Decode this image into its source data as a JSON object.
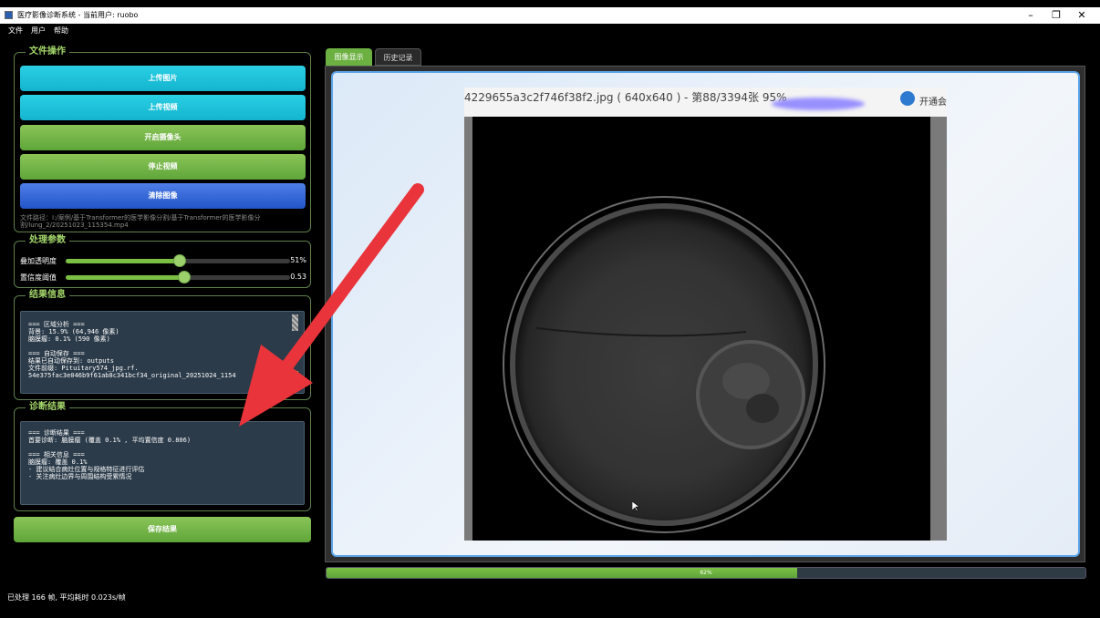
{
  "window": {
    "title": "医疗影像诊断系统 - 当前用户: ruobo",
    "minimize": "–",
    "maximize": "❐",
    "close": "✕"
  },
  "menu": [
    "文件",
    "用户",
    "帮助"
  ],
  "file_ops": {
    "title": "文件操作",
    "buttons": [
      "上传图片",
      "上传视频",
      "开启摄像头",
      "停止视频",
      "清除图像"
    ],
    "path": "文件路径：I:/案例/基于Transformer的医学影像分割/基于Transformer的医学影像分割/lung_2/20251023_115354.mp4"
  },
  "params": {
    "title": "处理参数",
    "overlay_label": "叠加透明度",
    "overlay_value": "51%",
    "overlay_level": 0.51,
    "conf_label": "置信度阈值",
    "conf_value": "0.53",
    "conf_level": 0.53
  },
  "result_info": {
    "title": "结果信息",
    "text": "=== 区域分析 ===\n背景: 15.9% (64,946 像素)\n脑膜瘤: 0.1% (590 像素)\n\n=== 自动保存 ===\n结果已自动保存到: outputs\n文件前缀: Pituitary574_jpg.rf.\n54e375fac3e046b9f61ab8c341bcf34_original_20251024_1154"
  },
  "diagnosis": {
    "title": "诊断结果",
    "text": "=== 诊断结果 ===\n首要诊断: 脑膜瘤 (覆盖 0.1% , 平均置信度 0.806)\n\n=== 相关信息 ===\n脑膜瘤: 覆盖 0.1%\n- 建议结合病灶位置与规格特征进行评估\n- 关注病灶边界与周围结构受累情况"
  },
  "save_button": "保存结果",
  "status": "已处理 166 帧, 平均耗时 0.023s/帧",
  "tabs": [
    "图像显示",
    "历史记录"
  ],
  "image_view": {
    "caption": "4229655a3c2f746f38f2.jpg ( 640x640 ) - 第88/3394张 95%",
    "share_text": "开通会"
  },
  "progress": {
    "value": 62,
    "label": "62%"
  },
  "colors": {
    "accent_green": "#7bc043",
    "cyan": "#14b4cf",
    "blue": "#2255c8",
    "arrow_red": "#e8343a"
  }
}
